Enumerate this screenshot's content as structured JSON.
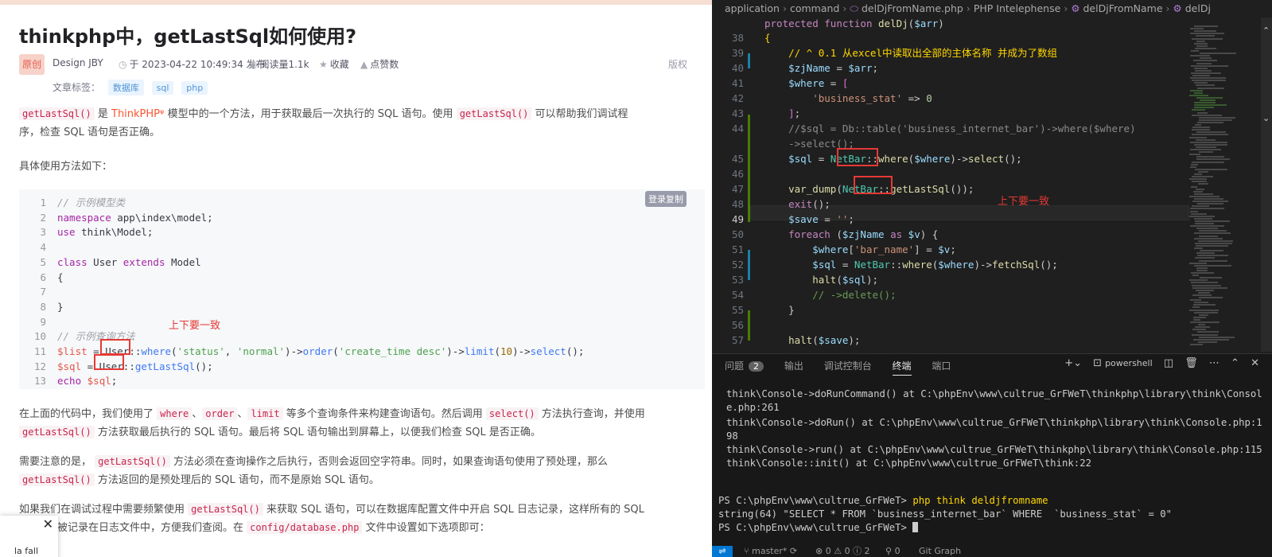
{
  "article": {
    "title": "thinkphp中，getLastSql如何使用?",
    "badge": "原创",
    "author": "Design JBY",
    "date": "于 2023-04-22 10:49:34 发布",
    "reads": "阅读量1.1k",
    "collect": "收藏",
    "likes": "点赞数",
    "copyright": "版权",
    "tags_label": "文章标签：",
    "tags": [
      "数据库",
      "sql",
      "php"
    ],
    "p1": {
      "code1": "getLastSql()",
      "t1": "是",
      "link": "ThinkPHP",
      "t2": "模型中的一个方法，用于获取最后一次执行的 SQL 语句。使用",
      "code2": "getLastSql()",
      "t3": "可以帮助我们调试程",
      "t4": "序，检查 SQL 语句是否正确。"
    },
    "p2": "具体使用方法如下：",
    "login_copy": "登录复制",
    "code_lines": [
      {
        "n": "1",
        "kind": "cmt",
        "text": "// 示例模型类"
      },
      {
        "n": "2",
        "kind": "ns",
        "text": "namespace app\\index\\model;"
      },
      {
        "n": "3",
        "kind": "use",
        "text": "use think\\Model;"
      },
      {
        "n": "4",
        "kind": "blank",
        "text": ""
      },
      {
        "n": "5",
        "kind": "class",
        "text": "class User extends Model"
      },
      {
        "n": "6",
        "kind": "plain",
        "text": "{"
      },
      {
        "n": "7",
        "kind": "blank",
        "text": ""
      },
      {
        "n": "8",
        "kind": "plain",
        "text": "}"
      },
      {
        "n": "9",
        "kind": "blank",
        "text": ""
      },
      {
        "n": "10",
        "kind": "cmt",
        "text": "// 示例查询方法"
      },
      {
        "n": "11",
        "kind": "l11",
        "text": "$list = User::where('status', 'normal')->order('create_time desc')->limit(10)->select();"
      },
      {
        "n": "12",
        "kind": "l12",
        "text": "$sql = User::getLastSql();"
      },
      {
        "n": "13",
        "kind": "l13",
        "text": "echo $sql;"
      }
    ],
    "annot_left": "上下要一致",
    "p3": {
      "t1": "在上面的代码中，我们使用了",
      "c1": "where",
      "s1": "、",
      "c2": "order",
      "s2": "、",
      "c3": "limit",
      "t2": "等多个查询条件来构建查询语句。然后调用",
      "c4": "select()",
      "t3": "方法执行查询，并使用",
      "c5": "getLastSql()",
      "t4": "方法获取最后执行的 SQL 语句。最后将 SQL 语句输出到屏幕上，以便我们检查 SQL 是否正确。"
    },
    "p4": {
      "t1": "需要注意的是，",
      "c1": "getLastSql()",
      "t2": "方法必须在查询操作之后执行，否则会返回空字符串。同时，如果查询语句使用了预处理，那么",
      "c2": "getLastSql()",
      "t3": "方法返回的是预处理后的 SQL 语句，而不是原始 SQL 语句。"
    },
    "p5": {
      "t1": "如果我们在调试过程中需要频繁使用",
      "c1": "getLastSql()",
      "t2": "来获取 SQL 语句，可以在数据库配置文件中开启 SQL 日志记录，这样所有的 SQL",
      "t3": "被记录在日志文件中，方便我们查阅。在",
      "c2": "config/database.php",
      "t4": "文件中设置如下选项即可："
    },
    "popup_close": "✕",
    "popup_text": "la fall"
  },
  "editor": {
    "breadcrumb": [
      "application",
      "command",
      "delDjFromName.php",
      "PHP Intelephense",
      "delDjFromName",
      "delDj"
    ],
    "annot_right": "上下要一致",
    "panel_tabs": [
      "问题",
      "输出",
      "调试控制台",
      "终端",
      "端口"
    ],
    "problems_count": "2",
    "shell": "powershell",
    "terminal_lines": [
      "think\\Console->doRunCommand() at C:\\phpEnv\\www\\cultrue_GrFWeT\\thinkphp\\library\\think\\Consol",
      "e.php:261",
      "think\\Console->doRun() at C:\\phpEnv\\www\\cultrue_GrFWeT\\thinkphp\\library\\think\\Console.php:1",
      "98",
      "think\\Console->run() at C:\\phpEnv\\www\\cultrue_GrFWeT\\thinkphp\\library\\think\\Console.php:115",
      "think\\Console::init() at C:\\phpEnv\\www\\cultrue_GrFWeT\\think:22"
    ],
    "prompt1": "PS C:\\phpEnv\\www\\cultrue_GrFWeT> ",
    "cmd1": "php think deldjfromname",
    "output": "string(64) \"SELECT * FROM `business_internet_bar` WHERE  `business_stat` = 0\"",
    "prompt2": "PS C:\\phpEnv\\www\\cultrue_GrFWeT> ",
    "status": {
      "branch": "master*",
      "counts": "⊗ 0 ⚠ 0 ⓘ 2",
      "ports": "0",
      "git": "Git Graph"
    }
  }
}
